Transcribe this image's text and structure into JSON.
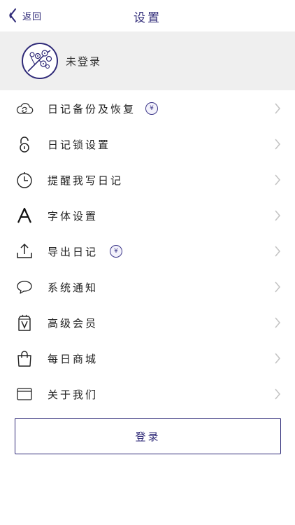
{
  "nav": {
    "back_label": "返回",
    "title": "设置"
  },
  "profile": {
    "name": "未登录",
    "avatar_icon": "plum-blossom-avatar"
  },
  "menu": [
    {
      "label": "日记备份及恢复",
      "icon": "cloud-sync-icon",
      "badge": "¥"
    },
    {
      "label": "日记锁设置",
      "icon": "lock-icon"
    },
    {
      "label": "提醒我写日记",
      "icon": "clock-icon"
    },
    {
      "label": "字体设置",
      "icon": "font-a-icon"
    },
    {
      "label": "导出日记",
      "icon": "export-icon",
      "badge": "¥"
    },
    {
      "label": "系统通知",
      "icon": "chat-bubble-icon"
    },
    {
      "label": "高级会员",
      "icon": "vip-tag-icon"
    },
    {
      "label": "每日商城",
      "icon": "shopping-bag-icon"
    },
    {
      "label": "关于我们",
      "icon": "card-icon"
    }
  ],
  "login_button": {
    "label": "登录"
  },
  "colors": {
    "accent": "#2f2a78",
    "profile_bg": "#efefef",
    "chevron": "#c4c4c4"
  }
}
